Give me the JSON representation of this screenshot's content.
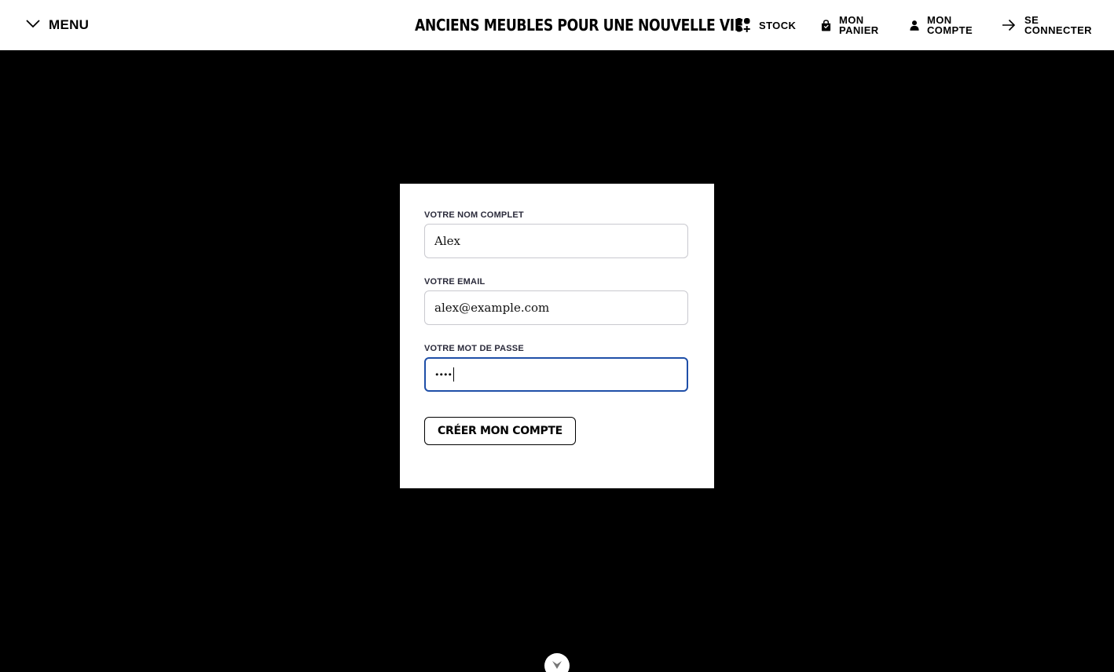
{
  "header": {
    "menu_label": "MENU",
    "site_title": "ANCIENS MEUBLES POUR UNE NOUVELLE VIE",
    "nav": [
      {
        "label": "STOCK",
        "icon": "grid-plus-icon"
      },
      {
        "label": "MON PANIER",
        "icon": "shopping-bag-icon"
      },
      {
        "label": "MON COMPTE",
        "icon": "user-icon"
      },
      {
        "label": "SE CONNECTER",
        "icon": "arrow-right-icon"
      }
    ]
  },
  "form": {
    "name_label": "VOTRE NOM COMPLET",
    "name_value": "Alex",
    "email_label": "VOTRE EMAIL",
    "email_value": "alex@example.com",
    "password_label": "VOTRE MOT DE PASSE",
    "password_masked": "••••",
    "submit_label": "CRÉER MON COMPTE"
  },
  "colors": {
    "background": "#000000",
    "surface": "#ffffff",
    "focus_border": "#1f4fa8"
  },
  "scroll_icon": "chevron-down-icon"
}
